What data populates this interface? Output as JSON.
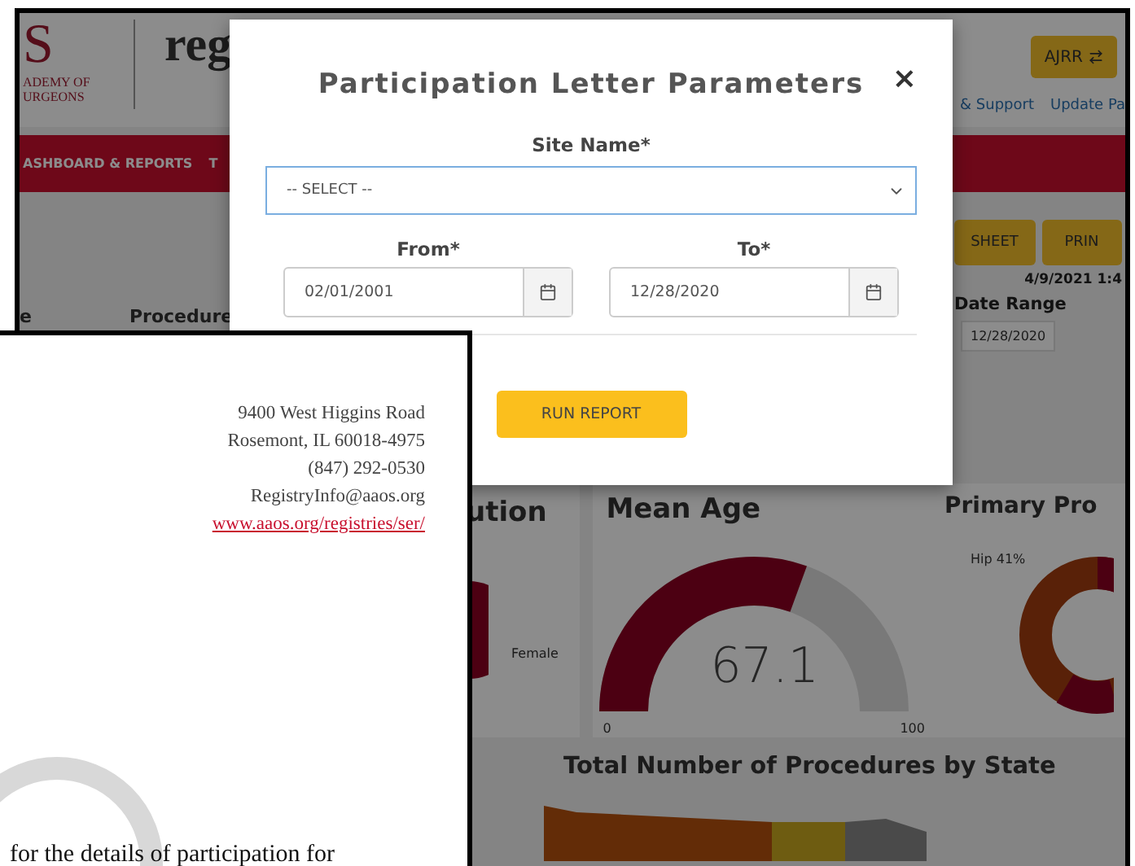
{
  "app": {
    "logo": {
      "letter": "S",
      "lines": [
        "ADEMY OF",
        "URGEONS"
      ],
      "brand": "reg"
    },
    "switch_button": "AJRR",
    "links": [
      "& Support",
      "Update Pa"
    ],
    "nav": [
      "ASHBOARD & REPORTS",
      "T"
    ],
    "action_buttons": [
      "SHEET",
      "PRIN"
    ],
    "timestamp": "4/9/2021 1:4",
    "date_range": {
      "label": "Date Range",
      "value": "12/28/2020"
    },
    "columns": [
      "e",
      "Procedure"
    ],
    "gender_panel": {
      "title": "ution",
      "legend": "Female"
    },
    "mean_age_panel": {
      "title": "Mean Age",
      "value": "67.1",
      "min": "0",
      "max": "100",
      "level": 0.671
    },
    "primary_panel": {
      "title": "Primary Pro",
      "label": "Hip 41%"
    },
    "map_panel": {
      "title": "Total Number of Procedures by State"
    }
  },
  "modal": {
    "title": "Participation Letter Parameters",
    "close": "×",
    "site": {
      "label": "Site Name*",
      "placeholder": "-- SELECT --"
    },
    "dates": [
      {
        "label": "From*",
        "value": "02/01/2001"
      },
      {
        "label": "To*",
        "value": "12/28/2020"
      }
    ],
    "submit": "RUN REPORT"
  },
  "letter": {
    "address": [
      "9400 West Higgins Road",
      "Rosemont, IL 60018-4975",
      "(847) 292-0530",
      "RegistryInfo@aaos.org"
    ],
    "link": "www.aaos.org/registries/ser/",
    "body": "for the details of participation for"
  }
}
